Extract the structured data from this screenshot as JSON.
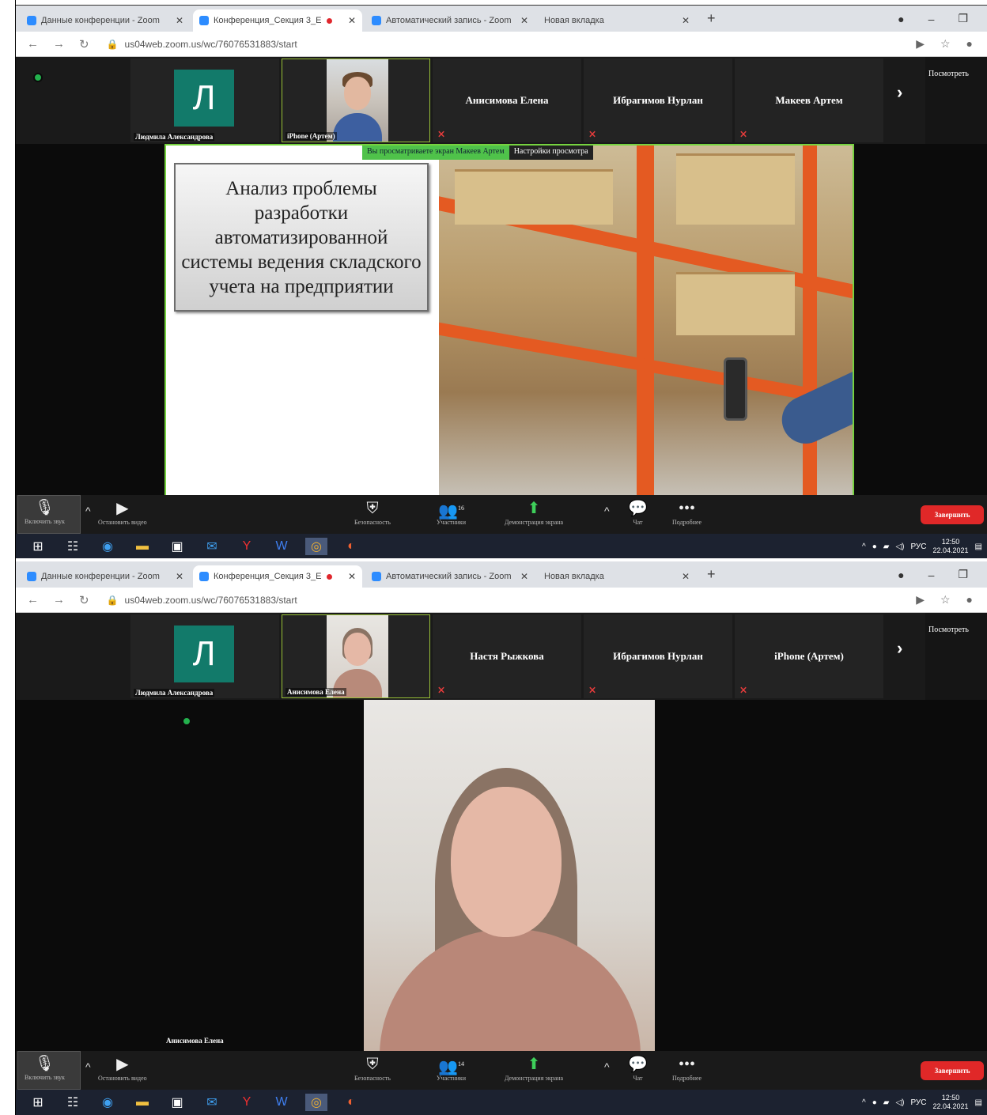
{
  "browser": {
    "tabs": [
      {
        "label": "Данные конференции - Zoom"
      },
      {
        "label": "Конференция_Секция 3_Е"
      },
      {
        "label": "Автоматический запись - Zoom"
      },
      {
        "label": "Новая вкладка"
      }
    ],
    "url": "us04web.zoom.us/wc/76076531883/start"
  },
  "screen1": {
    "tiles": [
      {
        "avatar": "Л",
        "name": "Людмила Александрова"
      },
      {
        "name": "iPhone (Артем)"
      },
      {
        "name": "Анисимова Елена"
      },
      {
        "name": "Ибрагимов Нурлан"
      },
      {
        "name": "Макеев Артем"
      }
    ],
    "view_button": "Посмотреть",
    "share_banner": {
      "viewing": "Вы просматриваете экран Макеев Артем",
      "settings": "Настройки просмотра"
    },
    "slide_title": "Анализ проблемы разработки автоматизированной системы ведения складского учета на предприятии",
    "participants_count": "16",
    "clock": {
      "time": "12:50",
      "date": "22.04.2021"
    }
  },
  "screen2": {
    "tiles": [
      {
        "avatar": "Л",
        "name": "Людмила Александрова"
      },
      {
        "name": "Анисимова Елена"
      },
      {
        "name": "Настя Рыжкова"
      },
      {
        "name": "Ибрагимов Нурлан"
      },
      {
        "name": "iPhone (Артем)"
      }
    ],
    "view_button": "Посмотреть",
    "speaker_name": "Анисимова Елена",
    "participants_count": "14",
    "clock": {
      "time": "12:50",
      "date": "22.04.2021"
    }
  },
  "toolbar": {
    "mic": "Включить звук",
    "video": "Остановить видео",
    "security": "Безопасность",
    "participants": "Участники",
    "share": "Демонстрация экрана",
    "chat": "Чат",
    "more": "Подробнее",
    "end": "Завершить"
  },
  "taskbar": {
    "lang": "РУС"
  },
  "colors": {
    "zoom_green": "#76d33f",
    "end_red": "#e02828",
    "avatar_teal": "#127a6a"
  }
}
